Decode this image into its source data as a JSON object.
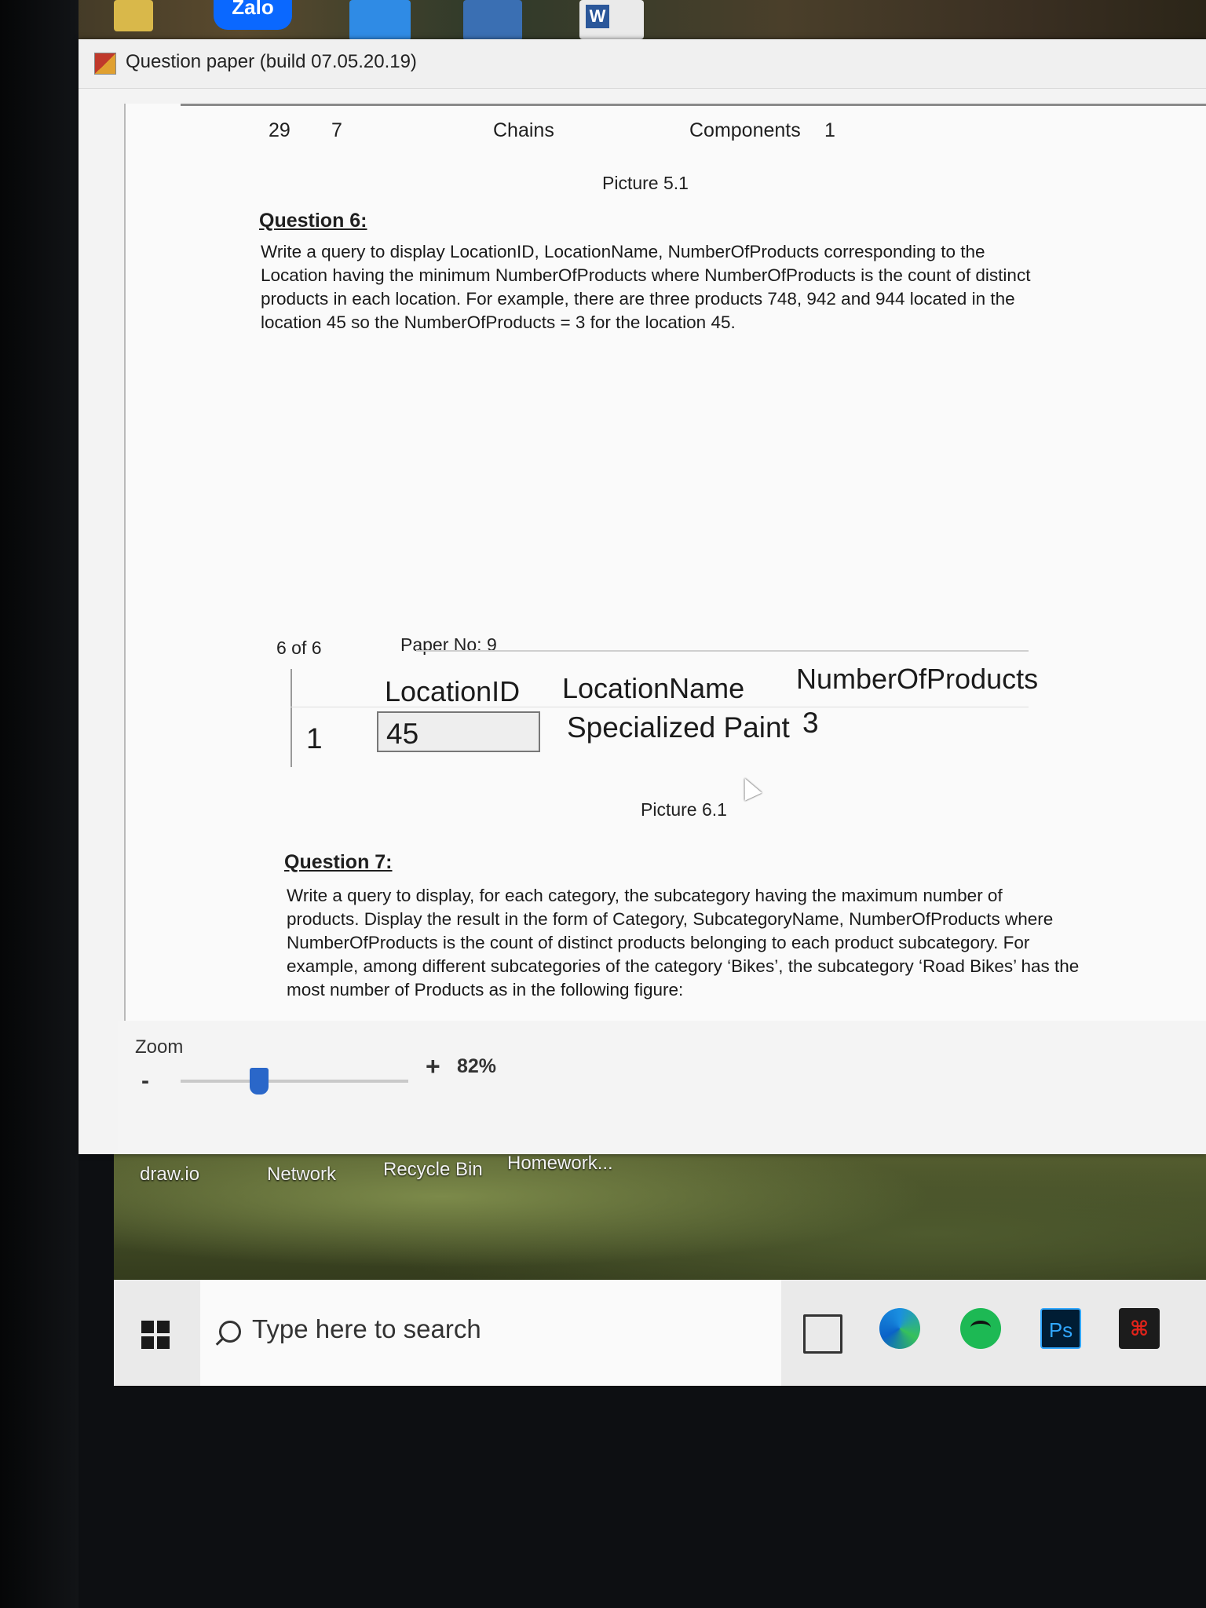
{
  "desktop": {
    "top_icons": [
      "zalo-icon",
      "app-shortcut-icon",
      "app-shortcut-icon",
      "word-icon"
    ],
    "zalo_label": "Zalo",
    "word_letter": "W",
    "shortcuts": [
      "draw.io",
      "Network",
      "Recycle Bin",
      "Homework..."
    ]
  },
  "window": {
    "title": "Question paper (build 07.05.20.19)"
  },
  "document": {
    "top_row": {
      "id": "29",
      "num": "7",
      "name": "Chains",
      "category": "Components",
      "count": "1"
    },
    "picture_5_caption": "Picture 5.1",
    "q6_heading": "Question 6:",
    "q6_body": "Write a query to display LocationID, LocationName, NumberOfProducts corresponding to the Location having the minimum NumberOfProducts where NumberOfProducts is the count of distinct products in each location. For example, there are three products 748, 942 and 944 located in the location 45 so the NumberOfProducts = 3 for the location 45.",
    "page_number": "6 of 6",
    "paper_no": "Paper No: 9",
    "result_grid": {
      "columns": [
        "LocationID",
        "LocationName",
        "NumberOfProducts"
      ],
      "row": {
        "index": "1",
        "location_id": "45",
        "location_name": "Specialized Paint",
        "number_of_products": "3"
      }
    },
    "picture_6_caption": "Picture 6.1",
    "q7_heading": "Question 7:",
    "q7_body": "Write a query to display, for each category, the subcategory having the maximum number of products. Display the result in the form of Category, SubcategoryName, NumberOfProducts where NumberOfProducts is the count of distinct products belonging to each product subcategory. For example, among different subcategories of the category ‘Bikes’, the subcategory ‘Road Bikes’ has the most number of Products as in the following figure:"
  },
  "zoom": {
    "label": "Zoom",
    "minus": "-",
    "plus": "+",
    "value": "82%",
    "level": 0.82
  },
  "taskbar": {
    "search_placeholder": "Type here to search",
    "ps_label": "Ps",
    "apps": [
      "task-view-icon",
      "edge-icon",
      "spotify-icon",
      "photoshop-icon",
      "garena-icon"
    ]
  },
  "colors": {
    "zoom_thumb": "#2a67c9",
    "title_icon": "#c0392b"
  }
}
